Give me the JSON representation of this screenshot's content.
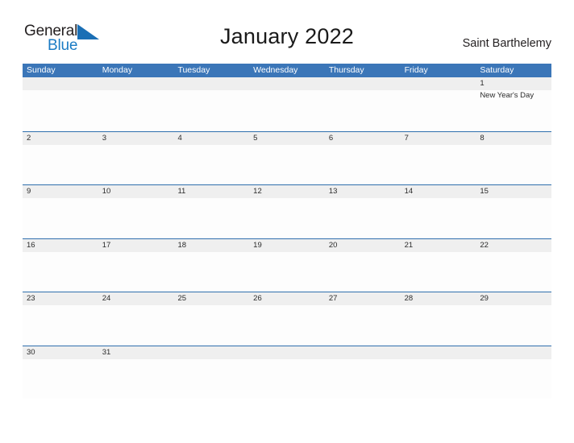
{
  "brand": {
    "word_one": "General",
    "word_two": "Blue",
    "flag_icon": "blue-flag-triangle",
    "color_dark": "#231f20",
    "color_blue": "#1a7bc4"
  },
  "header": {
    "title": "January 2022",
    "location": "Saint Barthelemy"
  },
  "calendar": {
    "header_color": "#3b76b8",
    "band_color": "#efefef",
    "row_border_color": "#2f6fad",
    "weekdays": [
      "Sunday",
      "Monday",
      "Tuesday",
      "Wednesday",
      "Thursday",
      "Friday",
      "Saturday"
    ],
    "weeks": [
      [
        {
          "day": "",
          "event": ""
        },
        {
          "day": "",
          "event": ""
        },
        {
          "day": "",
          "event": ""
        },
        {
          "day": "",
          "event": ""
        },
        {
          "day": "",
          "event": ""
        },
        {
          "day": "",
          "event": ""
        },
        {
          "day": "1",
          "event": "New Year's Day"
        }
      ],
      [
        {
          "day": "2",
          "event": ""
        },
        {
          "day": "3",
          "event": ""
        },
        {
          "day": "4",
          "event": ""
        },
        {
          "day": "5",
          "event": ""
        },
        {
          "day": "6",
          "event": ""
        },
        {
          "day": "7",
          "event": ""
        },
        {
          "day": "8",
          "event": ""
        }
      ],
      [
        {
          "day": "9",
          "event": ""
        },
        {
          "day": "10",
          "event": ""
        },
        {
          "day": "11",
          "event": ""
        },
        {
          "day": "12",
          "event": ""
        },
        {
          "day": "13",
          "event": ""
        },
        {
          "day": "14",
          "event": ""
        },
        {
          "day": "15",
          "event": ""
        }
      ],
      [
        {
          "day": "16",
          "event": ""
        },
        {
          "day": "17",
          "event": ""
        },
        {
          "day": "18",
          "event": ""
        },
        {
          "day": "19",
          "event": ""
        },
        {
          "day": "20",
          "event": ""
        },
        {
          "day": "21",
          "event": ""
        },
        {
          "day": "22",
          "event": ""
        }
      ],
      [
        {
          "day": "23",
          "event": ""
        },
        {
          "day": "24",
          "event": ""
        },
        {
          "day": "25",
          "event": ""
        },
        {
          "day": "26",
          "event": ""
        },
        {
          "day": "27",
          "event": ""
        },
        {
          "day": "28",
          "event": ""
        },
        {
          "day": "29",
          "event": ""
        }
      ],
      [
        {
          "day": "30",
          "event": ""
        },
        {
          "day": "31",
          "event": ""
        },
        {
          "day": "",
          "event": ""
        },
        {
          "day": "",
          "event": ""
        },
        {
          "day": "",
          "event": ""
        },
        {
          "day": "",
          "event": ""
        },
        {
          "day": "",
          "event": ""
        }
      ]
    ]
  }
}
